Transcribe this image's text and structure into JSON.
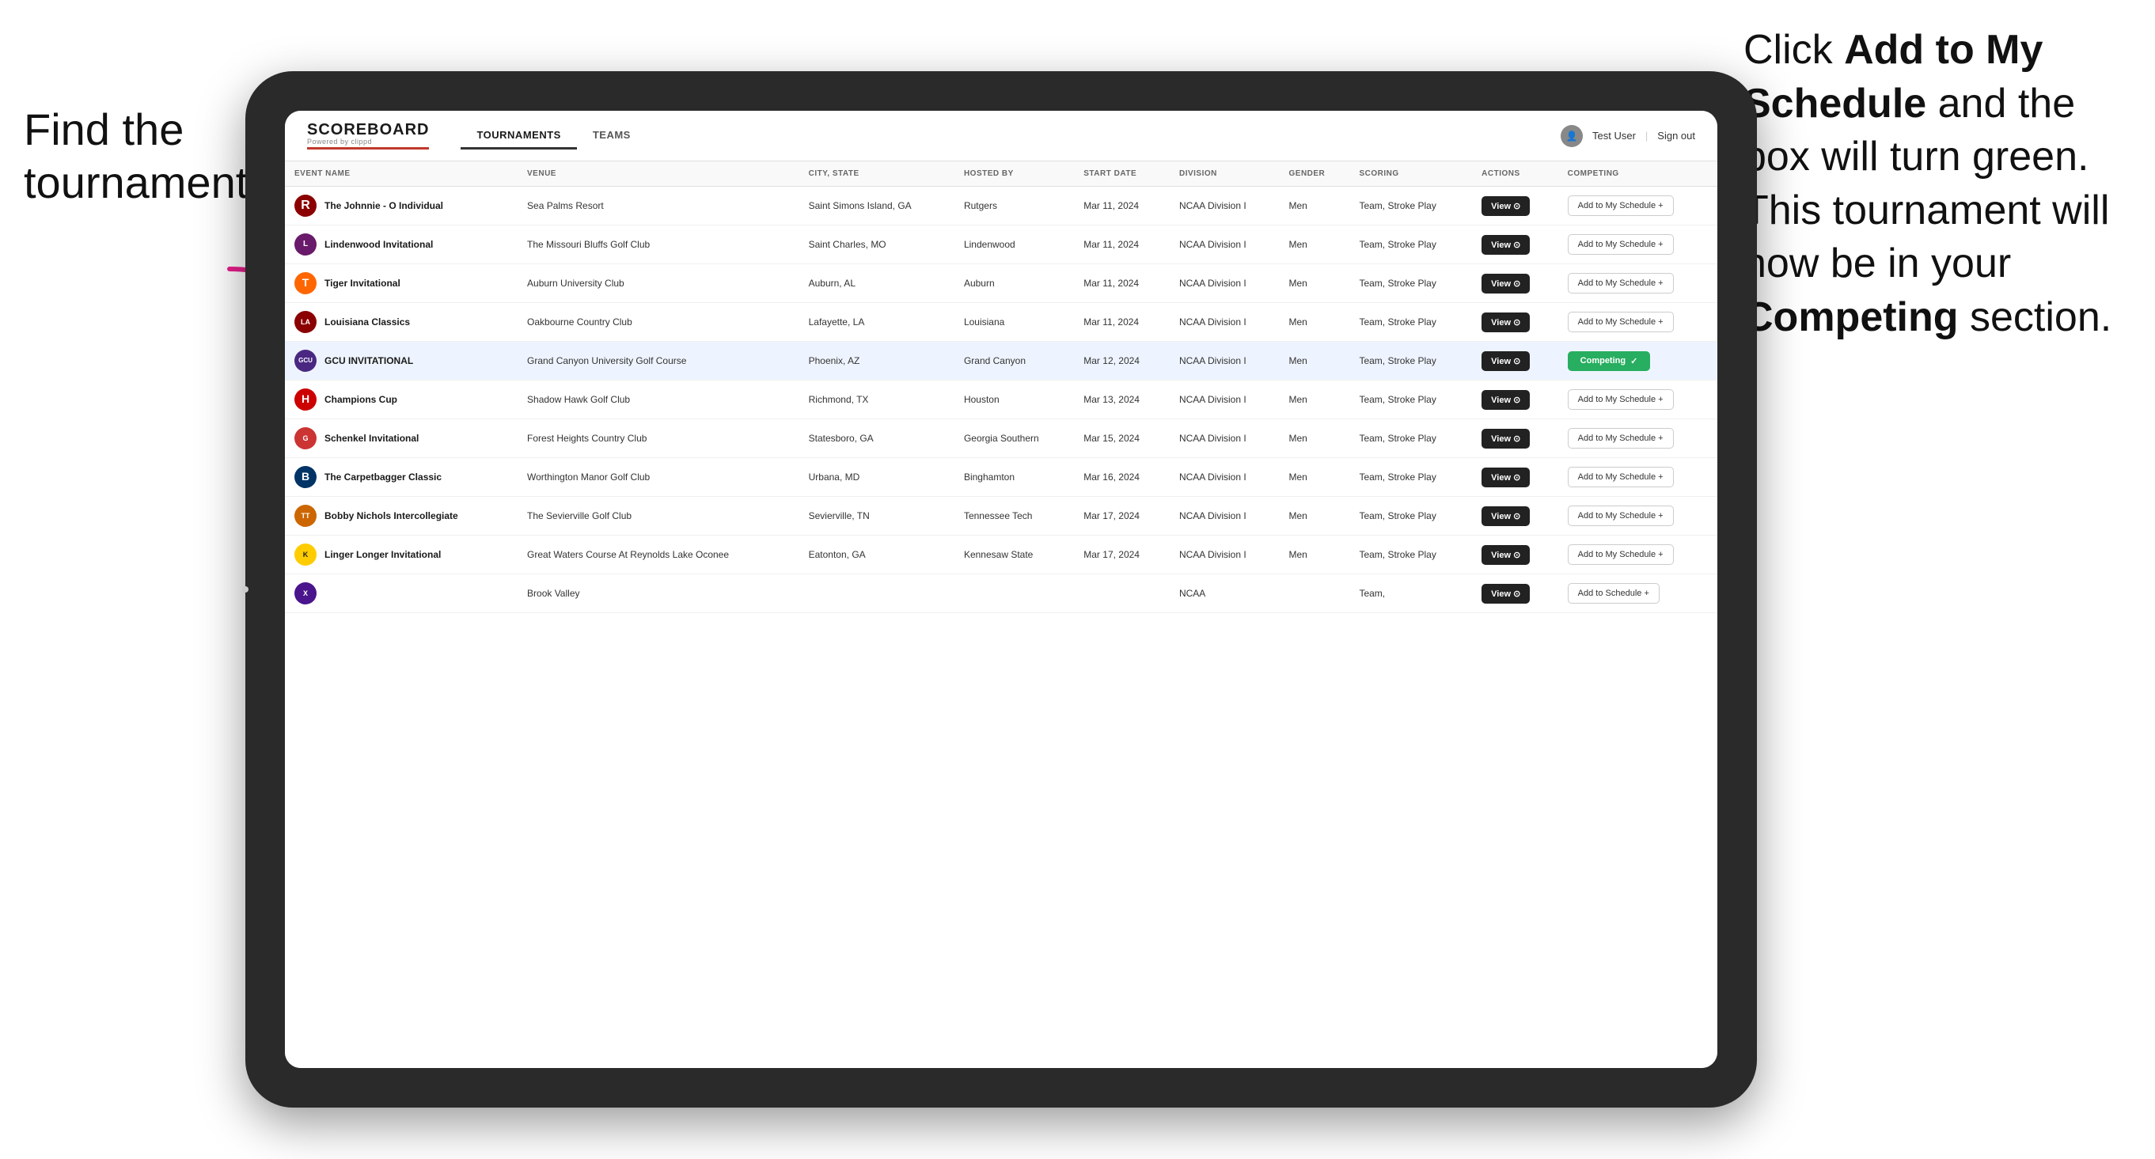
{
  "annotations": {
    "left": "Find the tournament.",
    "right_line1": "Click ",
    "right_bold1": "Add to My Schedule",
    "right_line2": " and the box will turn green. This tournament will now be in your ",
    "right_bold2": "Competing",
    "right_line3": " section."
  },
  "header": {
    "logo": "SCOREBOARD",
    "logo_sub": "Powered by clippd",
    "nav": [
      "TOURNAMENTS",
      "TEAMS"
    ],
    "active_nav": "TOURNAMENTS",
    "user": "Test User",
    "sign_out": "Sign out"
  },
  "table": {
    "columns": [
      "EVENT NAME",
      "VENUE",
      "CITY, STATE",
      "HOSTED BY",
      "START DATE",
      "DIVISION",
      "GENDER",
      "SCORING",
      "ACTIONS",
      "COMPETING"
    ],
    "rows": [
      {
        "logo": "R",
        "logo_class": "logo-r",
        "event": "The Johnnie - O Individual",
        "venue": "Sea Palms Resort",
        "city": "Saint Simons Island, GA",
        "hosted": "Rutgers",
        "date": "Mar 11, 2024",
        "division": "NCAA Division I",
        "gender": "Men",
        "scoring": "Team, Stroke Play",
        "action": "View",
        "competing": "Add to My Schedule +",
        "is_competing": false,
        "highlighted": false
      },
      {
        "logo": "L",
        "logo_class": "logo-l",
        "event": "Lindenwood Invitational",
        "venue": "The Missouri Bluffs Golf Club",
        "city": "Saint Charles, MO",
        "hosted": "Lindenwood",
        "date": "Mar 11, 2024",
        "division": "NCAA Division I",
        "gender": "Men",
        "scoring": "Team, Stroke Play",
        "action": "View",
        "competing": "Add to My Schedule +",
        "is_competing": false,
        "highlighted": false
      },
      {
        "logo": "T",
        "logo_class": "logo-t",
        "event": "Tiger Invitational",
        "venue": "Auburn University Club",
        "city": "Auburn, AL",
        "hosted": "Auburn",
        "date": "Mar 11, 2024",
        "division": "NCAA Division I",
        "gender": "Men",
        "scoring": "Team, Stroke Play",
        "action": "View",
        "competing": "Add to My Schedule +",
        "is_competing": false,
        "highlighted": false
      },
      {
        "logo": "LA",
        "logo_class": "logo-la",
        "event": "Louisiana Classics",
        "venue": "Oakbourne Country Club",
        "city": "Lafayette, LA",
        "hosted": "Louisiana",
        "date": "Mar 11, 2024",
        "division": "NCAA Division I",
        "gender": "Men",
        "scoring": "Team, Stroke Play",
        "action": "View",
        "competing": "Add to My Schedule +",
        "is_competing": false,
        "highlighted": false
      },
      {
        "logo": "GCU",
        "logo_class": "logo-gcu",
        "event": "GCU INVITATIONAL",
        "venue": "Grand Canyon University Golf Course",
        "city": "Phoenix, AZ",
        "hosted": "Grand Canyon",
        "date": "Mar 12, 2024",
        "division": "NCAA Division I",
        "gender": "Men",
        "scoring": "Team, Stroke Play",
        "action": "View",
        "competing": "Competing",
        "is_competing": true,
        "highlighted": true
      },
      {
        "logo": "H",
        "logo_class": "logo-h",
        "event": "Champions Cup",
        "venue": "Shadow Hawk Golf Club",
        "city": "Richmond, TX",
        "hosted": "Houston",
        "date": "Mar 13, 2024",
        "division": "NCAA Division I",
        "gender": "Men",
        "scoring": "Team, Stroke Play",
        "action": "View",
        "competing": "Add to My Schedule +",
        "is_competing": false,
        "highlighted": false
      },
      {
        "logo": "G",
        "logo_class": "logo-g",
        "event": "Schenkel Invitational",
        "venue": "Forest Heights Country Club",
        "city": "Statesboro, GA",
        "hosted": "Georgia Southern",
        "date": "Mar 15, 2024",
        "division": "NCAA Division I",
        "gender": "Men",
        "scoring": "Team, Stroke Play",
        "action": "View",
        "competing": "Add to My Schedule +",
        "is_competing": false,
        "highlighted": false
      },
      {
        "logo": "B",
        "logo_class": "logo-b",
        "event": "The Carpetbagger Classic",
        "venue": "Worthington Manor Golf Club",
        "city": "Urbana, MD",
        "hosted": "Binghamton",
        "date": "Mar 16, 2024",
        "division": "NCAA Division I",
        "gender": "Men",
        "scoring": "Team, Stroke Play",
        "action": "View",
        "competing": "Add to My Schedule +",
        "is_competing": false,
        "highlighted": false
      },
      {
        "logo": "TT",
        "logo_class": "logo-tt",
        "event": "Bobby Nichols Intercollegiate",
        "venue": "The Sevierville Golf Club",
        "city": "Sevierville, TN",
        "hosted": "Tennessee Tech",
        "date": "Mar 17, 2024",
        "division": "NCAA Division I",
        "gender": "Men",
        "scoring": "Team, Stroke Play",
        "action": "View",
        "competing": "Add to My Schedule +",
        "is_competing": false,
        "highlighted": false
      },
      {
        "logo": "K",
        "logo_class": "logo-k",
        "event": "Linger Longer Invitational",
        "venue": "Great Waters Course At Reynolds Lake Oconee",
        "city": "Eatonton, GA",
        "hosted": "Kennesaw State",
        "date": "Mar 17, 2024",
        "division": "NCAA Division I",
        "gender": "Men",
        "scoring": "Team, Stroke Play",
        "action": "View",
        "competing": "Add to My Schedule +",
        "is_competing": false,
        "highlighted": false
      },
      {
        "logo": "X",
        "logo_class": "logo-last",
        "event": "",
        "venue": "Brook Valley",
        "city": "",
        "hosted": "",
        "date": "",
        "division": "NCAA",
        "gender": "",
        "scoring": "Team,",
        "action": "View",
        "competing": "Add to Schedule +",
        "is_competing": false,
        "highlighted": false
      }
    ]
  }
}
